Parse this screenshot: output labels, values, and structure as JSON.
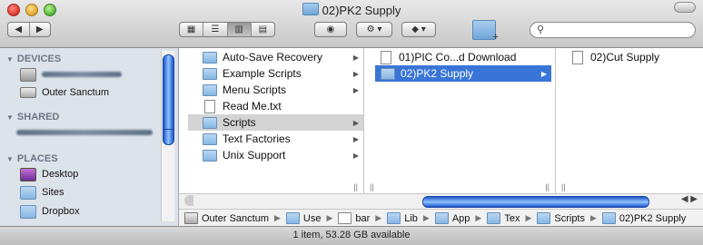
{
  "window": {
    "title": "02)PK2 Supply"
  },
  "toolbar": {
    "back": "◀",
    "forward": "▶",
    "view_icons": [
      "▦",
      "☰",
      "▥",
      "▤"
    ],
    "eye": "◉",
    "gear": "⚙ ▾",
    "dropbox": "◆ ▾",
    "search": {
      "value": "",
      "placeholder": ""
    }
  },
  "sidebar": {
    "devices": {
      "label": "DEVICES",
      "items": [
        "Outer Sanctum"
      ]
    },
    "shared": {
      "label": "SHARED"
    },
    "places": {
      "label": "PLACES",
      "items": [
        "Desktop",
        "Sites",
        "Dropbox"
      ]
    }
  },
  "columns": [
    {
      "items": [
        "Auto-Save Recovery",
        "Example Scripts",
        "Menu Scripts",
        "Read Me.txt",
        "Scripts",
        "Text Factories",
        "Unix Support"
      ]
    },
    {
      "items": [
        "01)PIC Co...d Download",
        "02)PK2 Supply"
      ]
    },
    {
      "items": [
        "02)Cut Supply"
      ]
    }
  ],
  "pathbar": {
    "crumbs": [
      "Outer Sanctum",
      "Use",
      "bar",
      "Lib",
      "App",
      "Tex",
      "Scripts",
      "02)PK2 Supply"
    ]
  },
  "status": {
    "text": "1 item, 53.28 GB available"
  },
  "colors": {
    "selection": "#3875d7",
    "sidebar": "#dde3ea",
    "scroll_thumb": "#1d55c9"
  }
}
